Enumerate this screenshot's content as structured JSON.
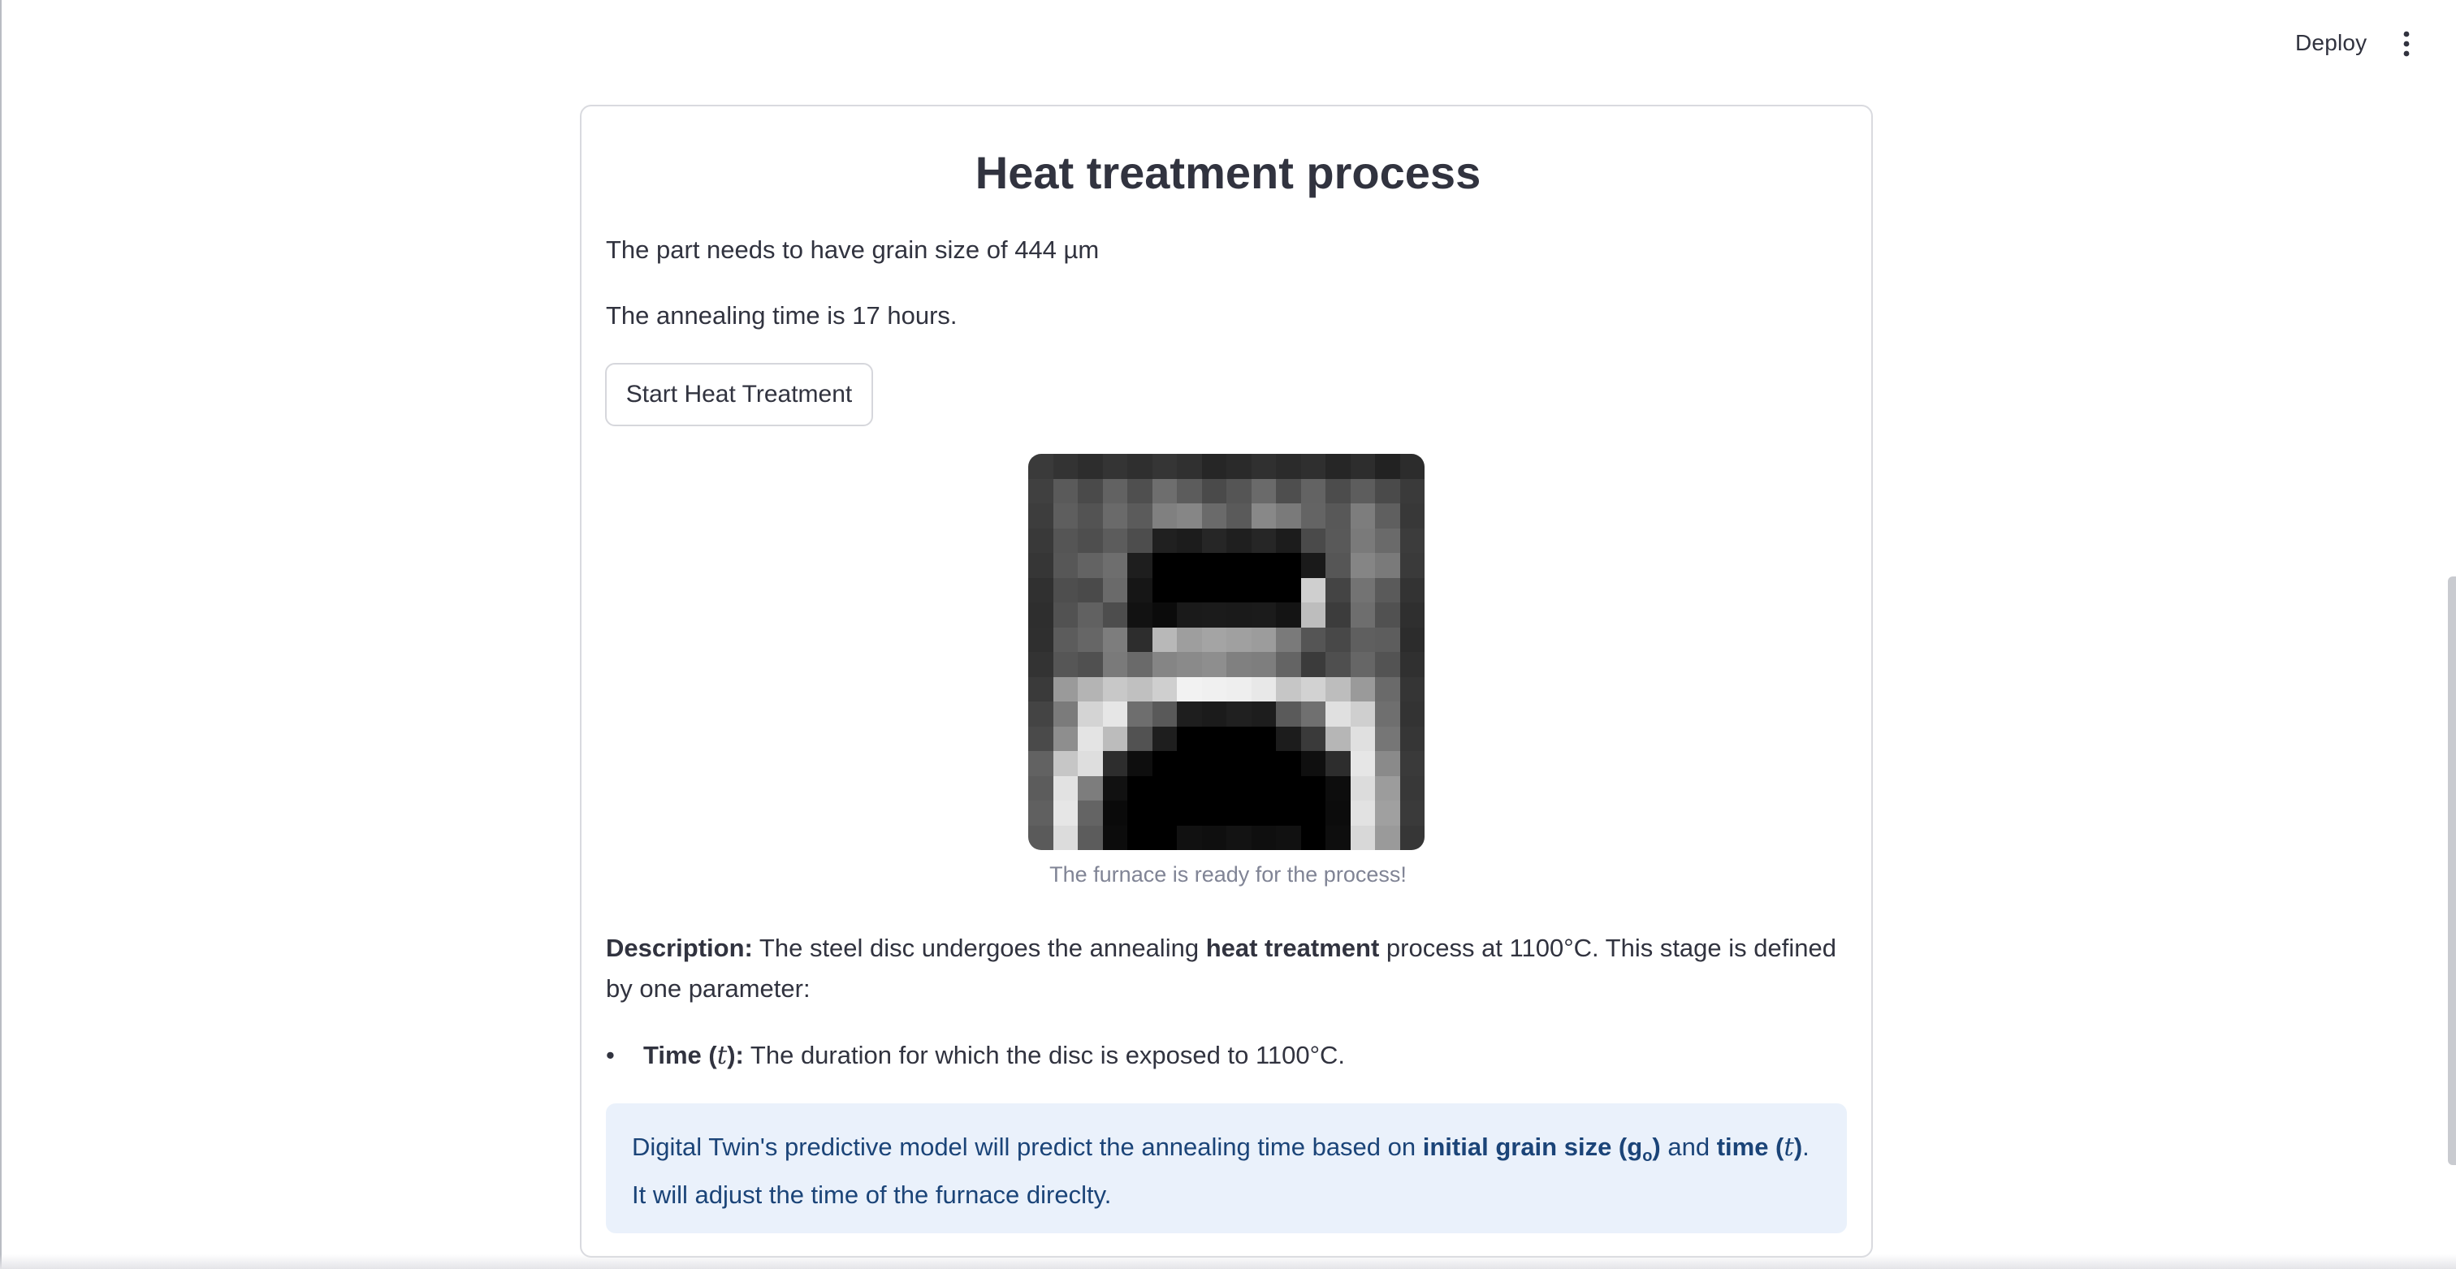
{
  "header": {
    "deploy_label": "Deploy",
    "menu_icon": "more-vertical-icon"
  },
  "card": {
    "title": "Heat treatment process",
    "grain_size_text": "The part needs to have grain size of 444 µm",
    "annealing_time_text": "The annealing time is 17 hours.",
    "start_button_label": "Start Heat Treatment",
    "image_caption": "The furnace is ready for the process!",
    "description": {
      "label": "Description:",
      "text1": " The steel disc undergoes the annealing ",
      "bold": "heat treatment",
      "text2": " process at 1100°C. This stage is defined by one parameter:"
    },
    "bullet": {
      "label_prefix": "Time (",
      "label_var": "t",
      "label_suffix": "):",
      "text": " The duration for which the disc is exposed to 1100°C."
    },
    "info": {
      "text1": "Digital Twin's predictive model will predict the annealing time based on ",
      "bold1": "initial grain size (g",
      "sub": "o",
      "bold1_end": ")",
      "text2": " and ",
      "bold2_prefix": "time (",
      "bold2_var": "t",
      "bold2_suffix": ")",
      "text3": ". It will adjust the time of the furnace direclty."
    }
  },
  "furnace_pixels": [
    [
      "#3a3a3a",
      "#333333",
      "#2d2d2d",
      "#343434",
      "#2f2f2f",
      "#353535",
      "#303030",
      "#262626",
      "#2a2a2a",
      "#303030",
      "#2b2b2b",
      "#2f2f2f",
      "#262626",
      "#2d2d2d",
      "#222222",
      "#2c2c2c"
    ],
    [
      "#404040",
      "#5a5a5a",
      "#4a4a4a",
      "#626262",
      "#4f4f4f",
      "#6e6e6e",
      "#5c5c5c",
      "#4a4a4a",
      "#555555",
      "#6a6a6a",
      "#4e4e4e",
      "#636363",
      "#4c4c4c",
      "#5d5d5d",
      "#4a4a4a",
      "#3a3a3a"
    ],
    [
      "#3d3d3d",
      "#5e5e5e",
      "#535353",
      "#6a6a6a",
      "#5b5b5b",
      "#808080",
      "#868686",
      "#6a6a6a",
      "#5a5a5a",
      "#888888",
      "#7a7a7a",
      "#646464",
      "#585858",
      "#7d7d7d",
      "#5f5f5f",
      "#383838"
    ],
    [
      "#393939",
      "#555555",
      "#4e4e4e",
      "#5c5c5c",
      "#4d4d4d",
      "#202020",
      "#1c1c1c",
      "#262626",
      "#1f1f1f",
      "#262626",
      "#1c1c1c",
      "#4a4a4a",
      "#595959",
      "#7a7a7a",
      "#6a6a6a",
      "#3c3c3c"
    ],
    [
      "#363636",
      "#575757",
      "#636363",
      "#6e6e6e",
      "#1e1e1e",
      "#000000",
      "#000000",
      "#000000",
      "#000000",
      "#000000",
      "#000000",
      "#1a1a1a",
      "#565656",
      "#858585",
      "#7a7a7a",
      "#3a3a3a"
    ],
    [
      "#303030",
      "#4e4e4e",
      "#4a4a4a",
      "#6a6a6a",
      "#161616",
      "#000000",
      "#000000",
      "#000000",
      "#000000",
      "#000000",
      "#000000",
      "#cfcfcf",
      "#444444",
      "#737373",
      "#5a5a5a",
      "#333333"
    ],
    [
      "#2e2e2e",
      "#525252",
      "#616161",
      "#4d4d4d",
      "#121212",
      "#0b0b0b",
      "#1a1a1a",
      "#1b1b1b",
      "#1a1a1a",
      "#1b1b1b",
      "#141414",
      "#bdbdbd",
      "#3c3c3c",
      "#6e6e6e",
      "#515151",
      "#2f2f2f"
    ],
    [
      "#2f2f2f",
      "#5c5c5c",
      "#666666",
      "#7d7d7d",
      "#2d2d2d",
      "#b8b8b8",
      "#9e9e9e",
      "#a4a4a4",
      "#a0a0a0",
      "#9c9c9c",
      "#7a7a7a",
      "#555555",
      "#484848",
      "#5f5f5f",
      "#5d5d5d",
      "#2c2c2c"
    ],
    [
      "#333333",
      "#565656",
      "#505050",
      "#7a7a7a",
      "#6a6a6a",
      "#858585",
      "#8a8a8a",
      "#8e8e8e",
      "#808080",
      "#7e7e7e",
      "#646464",
      "#3b3b3b",
      "#4f4f4f",
      "#666666",
      "#535353",
      "#303030"
    ],
    [
      "#3a3a3a",
      "#9a9a9a",
      "#b4b4b4",
      "#c8c8c8",
      "#c0c0c0",
      "#cfcfcf",
      "#f2f2f2",
      "#f0f0f0",
      "#eeeeee",
      "#e8e8e8",
      "#c6c6c6",
      "#d2d2d2",
      "#bdbdbd",
      "#9a9a9a",
      "#6a6a6a",
      "#353535"
    ],
    [
      "#444444",
      "#7b7b7b",
      "#d4d4d4",
      "#e6e6e6",
      "#6e6e6e",
      "#595959",
      "#1e1e1e",
      "#1b1b1b",
      "#202020",
      "#1d1d1d",
      "#5a5a5a",
      "#707070",
      "#e0e0e0",
      "#cfcfcf",
      "#6f6f6f",
      "#333333"
    ],
    [
      "#4a4a4a",
      "#8e8e8e",
      "#e4e4e4",
      "#bcbcbc",
      "#525252",
      "#1e1e1e",
      "#000000",
      "#000000",
      "#000000",
      "#000000",
      "#1c1c1c",
      "#3a3a3a",
      "#b6b6b6",
      "#e0e0e0",
      "#767676",
      "#363636"
    ],
    [
      "#626262",
      "#c6c6c6",
      "#dedede",
      "#2d2d2d",
      "#0e0e0e",
      "#000000",
      "#000000",
      "#000000",
      "#000000",
      "#000000",
      "#000000",
      "#0f0f0f",
      "#2d2d2d",
      "#e6e6e6",
      "#8a8a8a",
      "#3a3a3a"
    ],
    [
      "#5c5c5c",
      "#e2e2e2",
      "#7d7d7d",
      "#111111",
      "#000000",
      "#000000",
      "#000000",
      "#000000",
      "#000000",
      "#000000",
      "#000000",
      "#000000",
      "#0d0d0d",
      "#dcdcdc",
      "#9c9c9c",
      "#383838"
    ],
    [
      "#606060",
      "#e6e6e6",
      "#646464",
      "#0a0a0a",
      "#000000",
      "#000000",
      "#000000",
      "#000000",
      "#000000",
      "#000000",
      "#000000",
      "#000000",
      "#0c0c0c",
      "#e2e2e2",
      "#a0a0a0",
      "#3a3a3a"
    ],
    [
      "#5a5a5a",
      "#dcdcdc",
      "#5c5c5c",
      "#0c0c0c",
      "#000000",
      "#000000",
      "#111111",
      "#0f0f0f",
      "#131313",
      "#0f0f0f",
      "#111111",
      "#000000",
      "#0e0e0e",
      "#d8d8d8",
      "#9a9a9a",
      "#363636"
    ]
  ]
}
